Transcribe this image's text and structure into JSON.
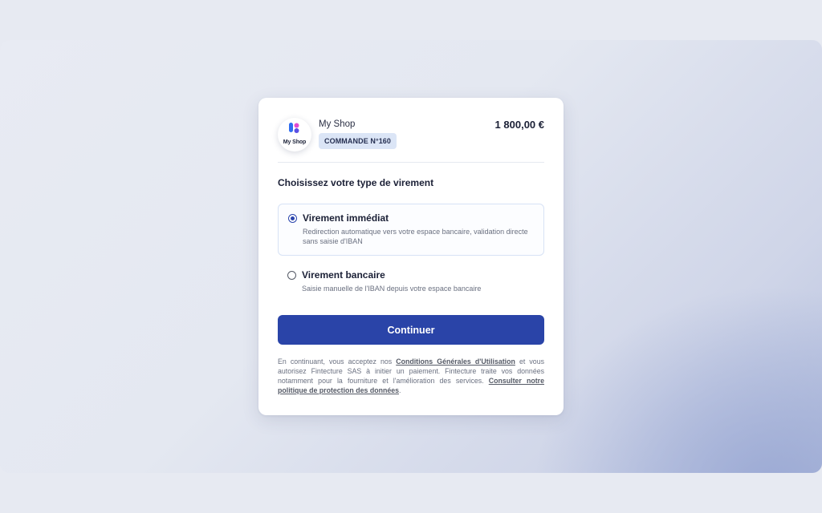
{
  "merchant": {
    "logo_text": "My Shop",
    "name": "My Shop",
    "order_badge": "COMMANDE N°160",
    "amount": "1 800,00 €"
  },
  "section_title": "Choisissez votre type de virement",
  "options": [
    {
      "title": "Virement immédiat",
      "description": "Redirection automatique vers votre espace bancaire, validation directe sans saisie d'IBAN",
      "selected": true
    },
    {
      "title": "Virement bancaire",
      "description": "Saisie manuelle de l'IBAN depuis votre espace bancaire",
      "selected": false
    }
  ],
  "continue_label": "Continuer",
  "legal": {
    "part1": "En continuant, vous acceptez nos ",
    "terms_link": "Conditions Générales d'Utilisation",
    "part2": " et vous autorisez Fintecture SAS à initier un paiement. Fintecture traite vos données notamment pour la fourniture et l'amélioration des services. ",
    "privacy_link": "Consulter notre politique de protection des données",
    "part3": "."
  },
  "colors": {
    "primary": "#2a44a8",
    "badge_bg": "#dbe5f6",
    "logo_blue": "#2f6df0",
    "logo_pink": "#e24ad1",
    "page_bg": "#e7eaf2"
  }
}
